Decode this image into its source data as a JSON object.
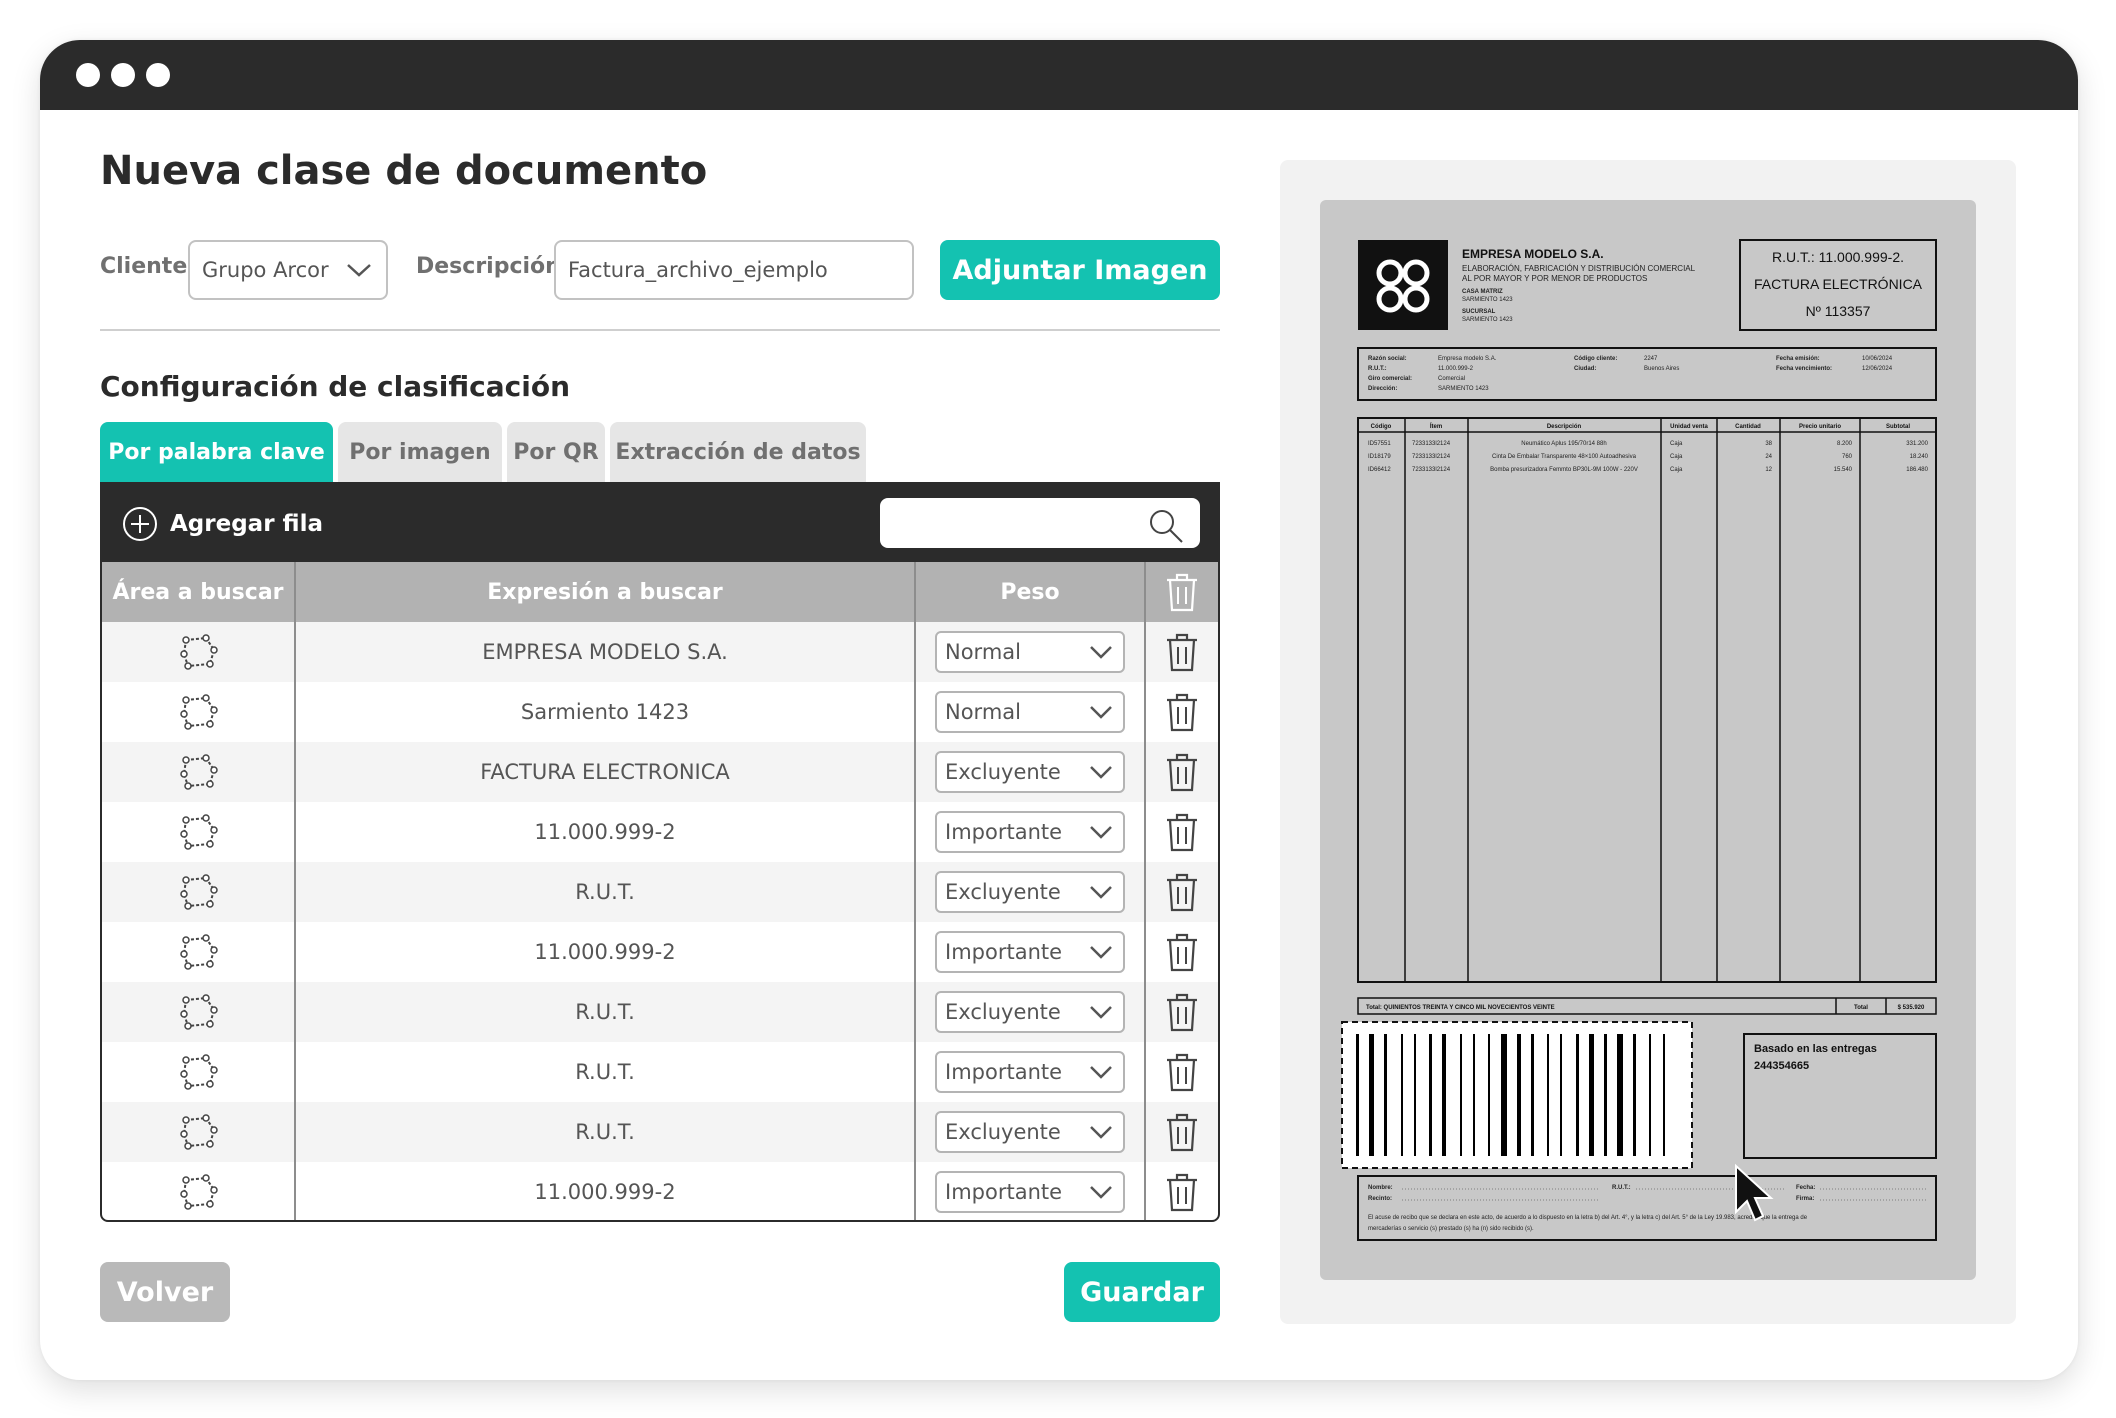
{
  "page": {
    "title": "Nueva clase de documento"
  },
  "form": {
    "client_label": "Cliente",
    "client_value": "Grupo Arcor",
    "description_label": "Descripción",
    "description_value": "Factura_archivo_ejemplo",
    "attach_button": "Adjuntar Imagen"
  },
  "config": {
    "title": "Configuración de clasificación",
    "tabs": [
      {
        "label": "Por palabra clave",
        "active": true
      },
      {
        "label": "Por imagen",
        "active": false
      },
      {
        "label": "Por QR",
        "active": false
      },
      {
        "label": "Extracción de datos",
        "active": false
      }
    ]
  },
  "table": {
    "add_row_label": "Agregar fila",
    "search_placeholder": "",
    "headers": {
      "area": "Área a buscar",
      "expression": "Expresión a buscar",
      "weight": "Peso"
    },
    "rows": [
      {
        "expression": "EMPRESA MODELO S.A.",
        "weight": "Normal"
      },
      {
        "expression": "Sarmiento 1423",
        "weight": "Normal"
      },
      {
        "expression": "FACTURA ELECTRONICA",
        "weight": "Excluyente"
      },
      {
        "expression": "11.000.999-2",
        "weight": "Importante"
      },
      {
        "expression": "R.U.T.",
        "weight": "Excluyente"
      },
      {
        "expression": "11.000.999-2",
        "weight": "Importante"
      },
      {
        "expression": "R.U.T.",
        "weight": "Excluyente"
      },
      {
        "expression": "R.U.T.",
        "weight": "Importante"
      },
      {
        "expression": "R.U.T.",
        "weight": "Excluyente"
      },
      {
        "expression": "11.000.999-2",
        "weight": "Importante"
      }
    ]
  },
  "actions": {
    "back": "Volver",
    "save": "Guardar"
  },
  "invoice": {
    "company": "EMPRESA MODELO S.A.",
    "company_desc_1": "ELABORACIÓN, FABRICACIÓN Y DISTRIBUCIÓN COMERCIAL",
    "company_desc_2": "AL POR MAYOR Y POR MENOR DE PRODUCTOS",
    "casa_matriz_label": "CASA MATRIZ",
    "casa_matriz": "SARMIENTO 1423",
    "sucursal_label": "SUCURSAL",
    "sucursal": "SARMIENTO 1423",
    "rut_header": "R.U.T.: 11.000.999-2.",
    "doc_type": "FACTURA ELECTRÓNICA",
    "doc_number": "Nº 113357",
    "info_labels": [
      "Razón social:",
      "R.U.T.:",
      "Giro comercial:",
      "Dirección:"
    ],
    "info_values": [
      "Empresa modelo S.A.",
      "11.000.999-2",
      "Comercial",
      "SARMIENTO 1423"
    ],
    "client_code_label": "Código cliente:",
    "client_code": "2247",
    "city_label": "Ciudad:",
    "city": "Buenos Aires",
    "issue_label": "Fecha emisión:",
    "issue_date": "10/06/2024",
    "due_label": "Fecha vencimiento:",
    "due_date": "12/06/2024",
    "columns": [
      "Código",
      "Ítem",
      "Descripción",
      "Unidad venta",
      "Cantidad",
      "Precio unitario",
      "Subtotal"
    ],
    "items": [
      [
        "ID57551",
        "7233133l2124",
        "Neumático Aplus 195/70r14 88h",
        "Caja",
        "38",
        "8.200",
        "331.200"
      ],
      [
        "ID18179",
        "7233133l2124",
        "Cinta De Embalar Transparente 48×100 Autoadhesiva",
        "Caja",
        "24",
        "760",
        "18.240"
      ],
      [
        "ID66412",
        "7233133l2124",
        "Bomba presurizadora Femmto BP30L-9M 100W - 220V",
        "Caja",
        "12",
        "15.540",
        "186.480"
      ]
    ],
    "total_words": "Total: QUINIENTOS TREINTA Y CINCO MIL NOVECIENTOS VEINTE",
    "total_label": "Total",
    "total_value": "$ 535.920",
    "based_on": "Basado en las entregas",
    "based_number": "244354665",
    "name_label": "Nombre:",
    "rut_label": "R.U.T.:",
    "date_label": "Fecha:",
    "recinto_label": "Recinto:",
    "firma_label": "Firma:",
    "legal_1": "El acuse de recibo que se declara en este acto, de acuerdo a lo dispuesto en la letra b) del Art. 4°, y la letra c) del Art. 5° de la Ley 19.983, acredita que la entrega de",
    "legal_2": "mercaderías o servicio (s) prestado (s) ha (n) sido recibido (s)."
  }
}
